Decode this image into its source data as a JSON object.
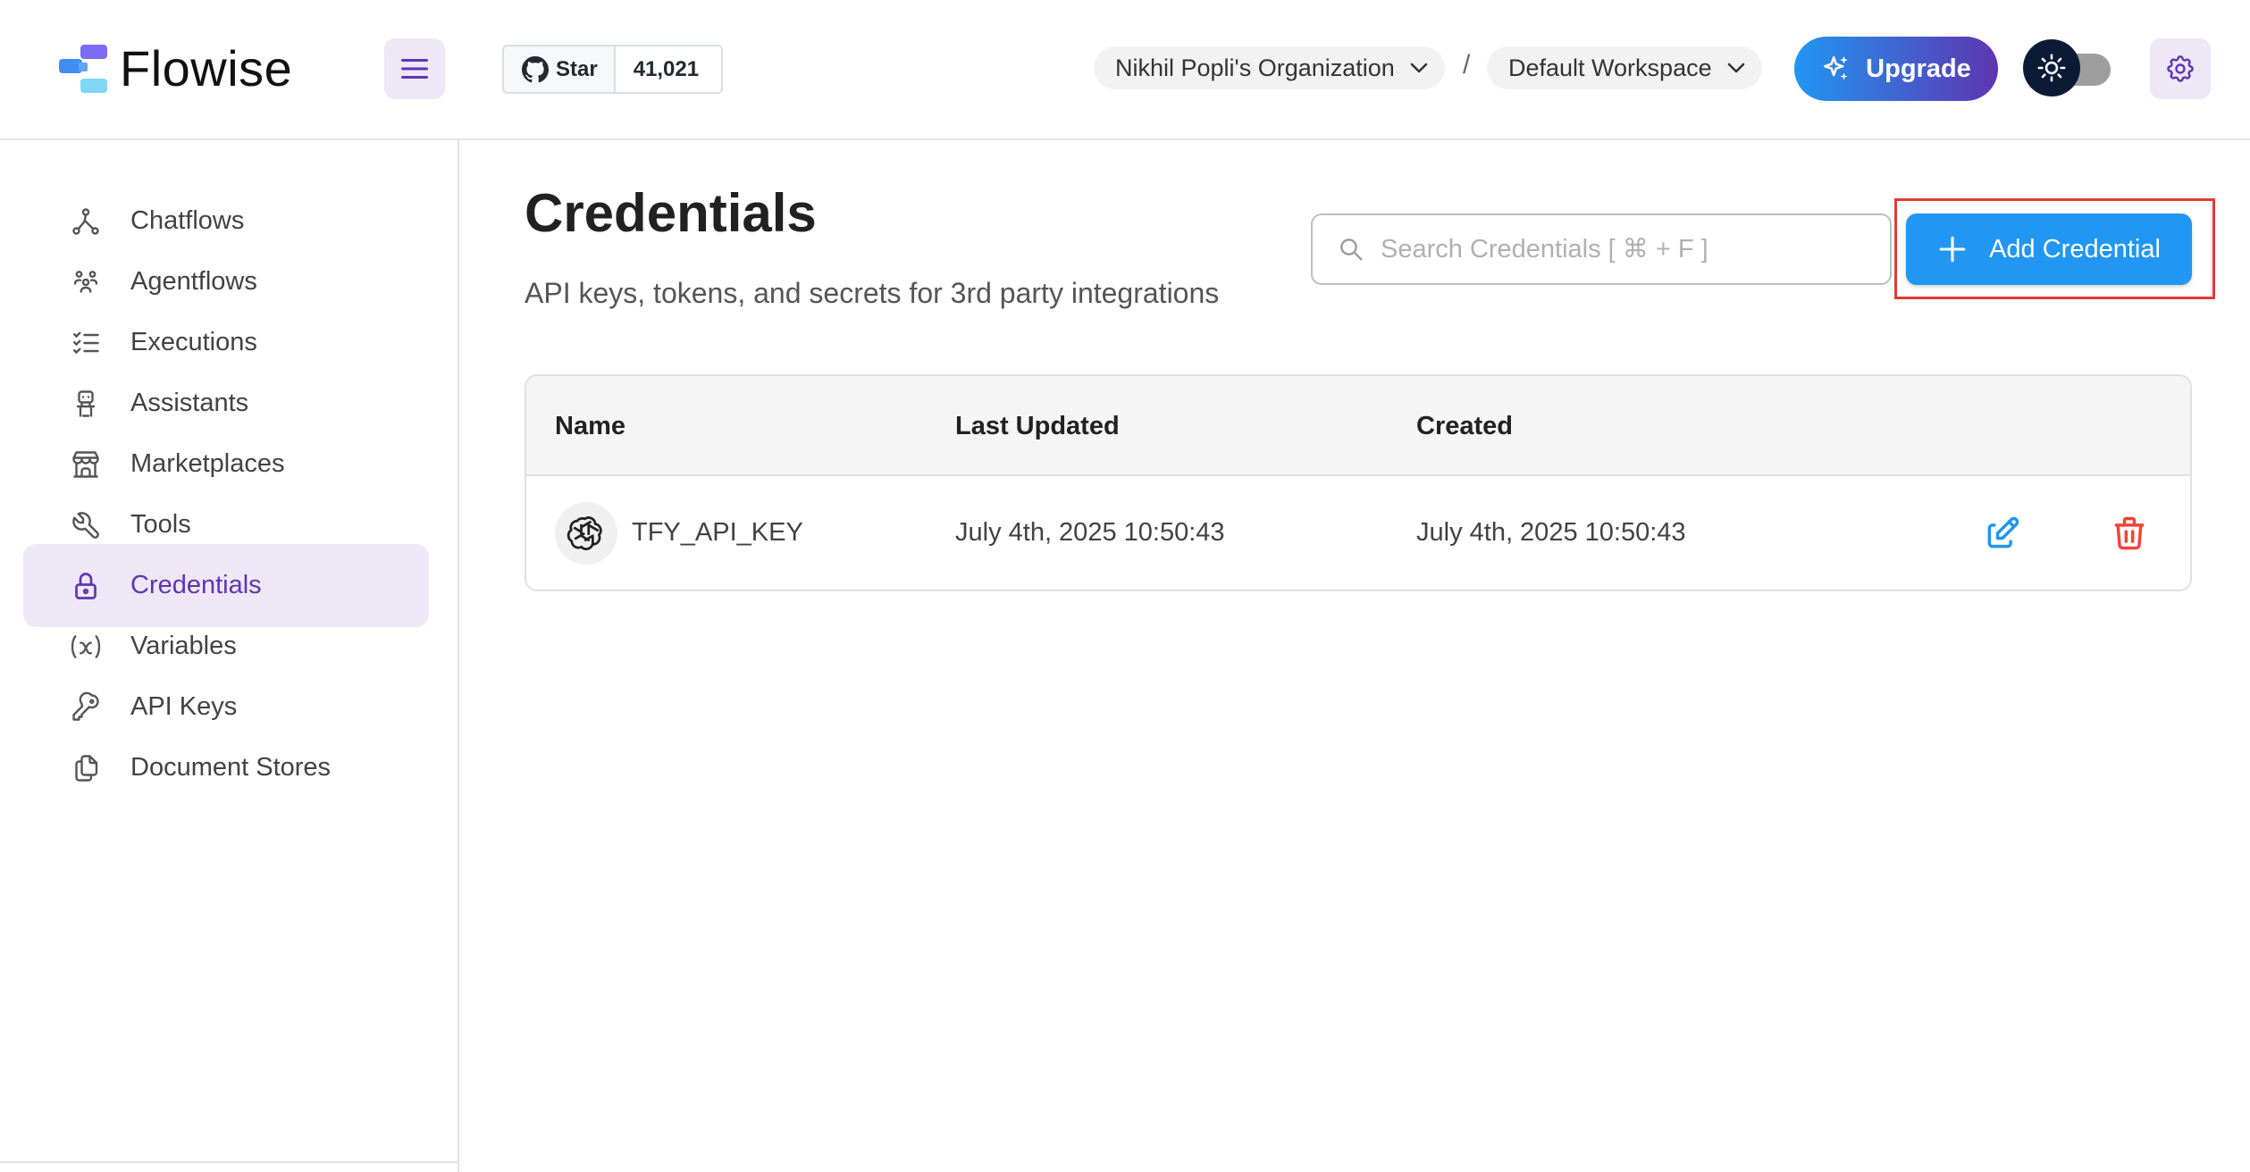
{
  "header": {
    "app_name": "Flowise",
    "github": {
      "star_label": "Star",
      "star_count": "41,021"
    },
    "organization": "Nikhil Popli's Organization",
    "separator": "/",
    "workspace": "Default Workspace",
    "upgrade_label": "Upgrade"
  },
  "sidebar": {
    "items": [
      {
        "label": "Chatflows",
        "icon": "hierarchy-icon"
      },
      {
        "label": "Agentflows",
        "icon": "users-group-icon"
      },
      {
        "label": "Executions",
        "icon": "list-check-icon"
      },
      {
        "label": "Assistants",
        "icon": "robot-icon"
      },
      {
        "label": "Marketplaces",
        "icon": "building-store-icon"
      },
      {
        "label": "Tools",
        "icon": "tool-icon"
      },
      {
        "label": "Credentials",
        "icon": "lock-icon",
        "active": true
      },
      {
        "label": "Variables",
        "icon": "variable-icon"
      },
      {
        "label": "API Keys",
        "icon": "key-icon"
      },
      {
        "label": "Document Stores",
        "icon": "files-icon"
      }
    ]
  },
  "main": {
    "title": "Credentials",
    "subtitle": "API keys, tokens, and secrets for 3rd party integrations",
    "search_placeholder": "Search Credentials [ ⌘ + F ]",
    "add_button_label": "Add Credential",
    "table": {
      "columns": [
        "Name",
        "Last Updated",
        "Created"
      ],
      "rows": [
        {
          "name": "TFY_API_KEY",
          "last_updated": "July 4th, 2025 10:50:43",
          "created": "July 4th, 2025 10:50:43"
        }
      ]
    }
  },
  "colors": {
    "primary": "#2196f3",
    "accent_purple": "#5e35b1",
    "active_bg": "#ede7f6",
    "delete_red": "#f44336",
    "highlight": "#e53935"
  }
}
